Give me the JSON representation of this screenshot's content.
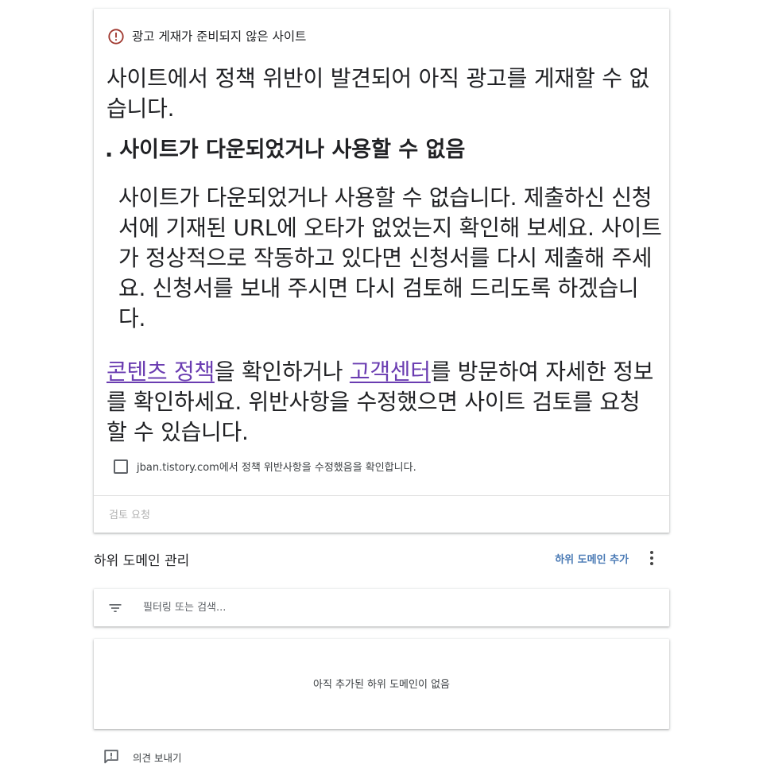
{
  "status_card": {
    "icon": "error-outline-icon",
    "status_label": "광고 게재가 준비되지 않은 사이트",
    "headline": "사이트에서 정책 위반이 발견되어 아직 광고를 게재할 수 없습니다.",
    "issue": {
      "bullet": ".",
      "title": "사이트가 다운되었거나 사용할 수 없음",
      "body": "사이트가 다운되었거나 사용할 수 없습니다. 제출하신 신청서에 기재된 URL에 오타가 없었는지 확인해 보세요. 사이트가 정상적으로 작동하고 있다면 신청서를 다시 제출해 주세요. 신청서를 보내 주시면 다시 검토해 드리도록 하겠습니다."
    },
    "info": {
      "link1": "콘텐츠 정책",
      "text1": "을 확인하거나 ",
      "link2": "고객센터",
      "text2": "를 방문하여 자세한 정보를 확인하세요. 위반사항을 수정했으면 사이트 검토를 요청할 수 있습니다."
    },
    "confirm_checkbox_label": "jban.tistory.com에서 정책 위반사항을 수정했음을 확인합니다.",
    "confirm_checked": false,
    "review_button": "검토 요청"
  },
  "subdomains": {
    "title": "하위 도메인 관리",
    "add_button": "하위 도메인 추가",
    "filter_placeholder": "필터링 또는 검색...",
    "empty_message": "아직 추가된 하위 도메인이 없음"
  },
  "feedback": {
    "label": "의견 보내기",
    "icon": "feedback-icon"
  },
  "colors": {
    "error": "#a0382f",
    "link": "#6a3cb1",
    "accent": "#4a7ab5",
    "disabled": "#b0b0b0"
  }
}
